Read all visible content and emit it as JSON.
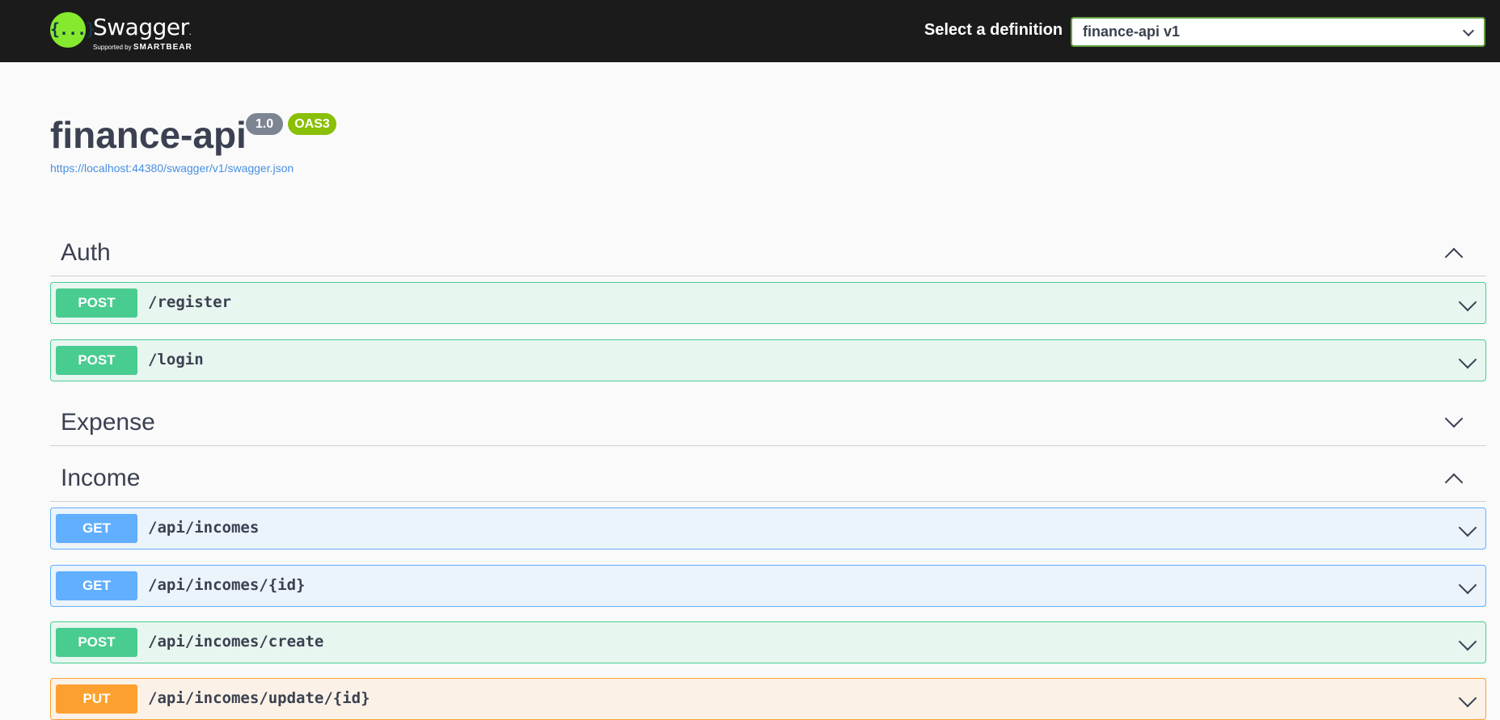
{
  "topbar": {
    "logo_icon": "{...}",
    "logo_title": "Swagger",
    "logo_tm": ".",
    "logo_sub_prefix": "Supported by",
    "logo_sub_brand": "SMARTBEAR",
    "definition_label": "Select a definition",
    "definition_selected": "finance-api v1"
  },
  "info": {
    "title": "finance-api",
    "version": "1.0",
    "oas": "OAS3",
    "url": "https://localhost:44380/swagger/v1/swagger.json"
  },
  "tags": [
    {
      "name": "Auth",
      "expanded": true,
      "operations": [
        {
          "method": "POST",
          "path": "/register"
        },
        {
          "method": "POST",
          "path": "/login"
        }
      ]
    },
    {
      "name": "Expense",
      "expanded": false,
      "operations": []
    },
    {
      "name": "Income",
      "expanded": true,
      "operations": [
        {
          "method": "GET",
          "path": "/api/incomes"
        },
        {
          "method": "GET",
          "path": "/api/incomes/{id}"
        },
        {
          "method": "POST",
          "path": "/api/incomes/create"
        },
        {
          "method": "PUT",
          "path": "/api/incomes/update/{id}"
        }
      ]
    }
  ],
  "icons": {
    "tag_expanded": "chevron-up-icon",
    "tag_collapsed": "chevron-down-icon",
    "op_toggle": "chevron-down-icon"
  },
  "colors": {
    "topbar": "#1b1b1b",
    "logo": "#85ea2d",
    "post": "#49cc90",
    "get": "#61affe",
    "put": "#fca130",
    "version_badge": "#7d8492",
    "oas_badge": "#89bf04"
  }
}
